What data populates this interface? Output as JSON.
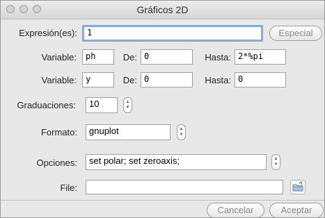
{
  "window": {
    "title": "Gráficos 2D"
  },
  "expression": {
    "label": "Expresión(es):",
    "value": "1",
    "special_button": "Especial"
  },
  "variable1": {
    "label": "Variable:",
    "value": "ph",
    "from_label": "De:",
    "from_value": "0",
    "to_label": "Hasta:",
    "to_value": "2*%pi"
  },
  "variable2": {
    "label": "Variable:",
    "value": "y",
    "from_label": "De:",
    "from_value": "0",
    "to_label": "Hasta:",
    "to_value": "0"
  },
  "graduations": {
    "label": "Graduaciones:",
    "value": "10"
  },
  "format": {
    "label": "Formato:",
    "value": "gnuplot"
  },
  "options": {
    "label": "Opciones:",
    "value": "set polar; set zeroaxis;"
  },
  "file": {
    "label": "File:",
    "value": ""
  },
  "footer": {
    "cancel": "Cancelar",
    "accept": "Aceptar"
  }
}
